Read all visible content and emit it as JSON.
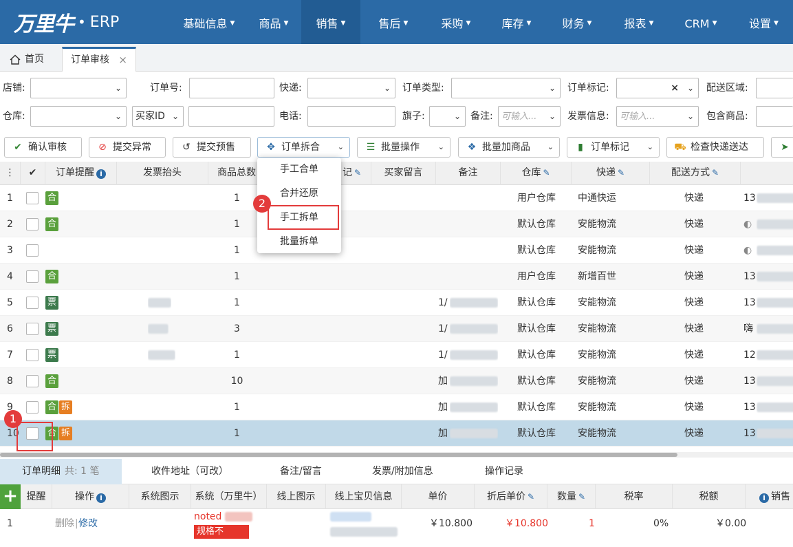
{
  "app": {
    "brand": "万里牛",
    "dot": "•",
    "product": "ERP"
  },
  "nav": [
    "基础信息",
    "商品",
    "销售",
    "售后",
    "采购",
    "库存",
    "财务",
    "报表",
    "CRM",
    "设置"
  ],
  "tabs": {
    "home": "首页",
    "current": "订单审核",
    "close": "×"
  },
  "filters": {
    "shop": "店铺:",
    "order_no": "订单号:",
    "express": "快递:",
    "order_type": "订单类型:",
    "order_mark": "订单标记:",
    "region": "配送区域:",
    "warehouse": "仓库:",
    "buyer_id": "买家ID",
    "phone": "电话:",
    "flag": "旗子:",
    "remark": "备注:",
    "remark_ph": "可输入...",
    "invoice": "发票信息:",
    "invoice_ph": "可输入...",
    "contains_goods": "包含商品:",
    "clear": "×"
  },
  "toolbar": {
    "confirm": "确认审核",
    "submit_exception": "提交异常",
    "submit_presale": "提交预售",
    "split_merge": "订单拆合",
    "batch_ops": "批量操作",
    "batch_add": "批量加商品",
    "order_mark": "订单标记",
    "check_express": "检查快递送达"
  },
  "grid": {
    "headers": [
      "订单提醒",
      "发票抬头",
      "商品总数",
      "记",
      "买家留言",
      "备注",
      "仓库",
      "快递",
      "配送方式"
    ],
    "rows": [
      {
        "n": "1",
        "badges": [
          "合"
        ],
        "qty": "1",
        "remark": "",
        "wh": "用户仓库",
        "exp": "中通快运",
        "ship": "快递",
        "extra": "13"
      },
      {
        "n": "2",
        "badges": [
          "合"
        ],
        "qty": "1",
        "remark": "",
        "wh": "默认仓库",
        "exp": "安能物流",
        "ship": "快递",
        "extra": ""
      },
      {
        "n": "3",
        "badges": [],
        "qty": "1",
        "remark": "",
        "wh": "默认仓库",
        "exp": "安能物流",
        "ship": "快递",
        "extra": ""
      },
      {
        "n": "4",
        "badges": [
          "合"
        ],
        "qty": "1",
        "remark": "",
        "wh": "用户仓库",
        "exp": "新增百世",
        "ship": "快递",
        "extra": "13"
      },
      {
        "n": "5",
        "badges": [
          "票"
        ],
        "qty": "1",
        "remark": "1/",
        "wh": "默认仓库",
        "exp": "安能物流",
        "ship": "快递",
        "extra": "13"
      },
      {
        "n": "6",
        "badges": [
          "票"
        ],
        "qty": "3",
        "remark": "1/",
        "wh": "默认仓库",
        "exp": "安能物流",
        "ship": "快递",
        "extra": "嗨"
      },
      {
        "n": "7",
        "badges": [
          "票"
        ],
        "qty": "1",
        "remark": "1/",
        "wh": "默认仓库",
        "exp": "安能物流",
        "ship": "快递",
        "extra": "12"
      },
      {
        "n": "8",
        "badges": [
          "合"
        ],
        "qty": "10",
        "remark": "加",
        "wh": "默认仓库",
        "exp": "安能物流",
        "ship": "快递",
        "extra": "13"
      },
      {
        "n": "9",
        "badges": [
          "合",
          "拆"
        ],
        "qty": "1",
        "remark": "加",
        "wh": "默认仓库",
        "exp": "安能物流",
        "ship": "快递",
        "extra": "13"
      },
      {
        "n": "10",
        "badges": [
          "合",
          "拆"
        ],
        "qty": "1",
        "remark": "加",
        "wh": "默认仓库",
        "exp": "安能物流",
        "ship": "快递",
        "extra": "13"
      }
    ]
  },
  "menu": [
    "手工合单",
    "合并还原",
    "手工拆单",
    "批量拆单"
  ],
  "annotations": {
    "one": "1",
    "two": "2"
  },
  "bottom_tabs": {
    "detail": "订单明细",
    "count": "共: 1 笔",
    "address": "收件地址（可改）",
    "notes": "备注/留言",
    "invoice": "发票/附加信息",
    "log": "操作记录"
  },
  "detail_headers": {
    "remind": "提醒",
    "ops": "操作",
    "sys_img": "系统图示",
    "sys": "系统（万里牛）",
    "online_img": "线上图示",
    "online_info": "线上宝贝信息",
    "price": "单价",
    "disc_price": "折后单价",
    "qty": "数量",
    "tax_rate": "税率",
    "tax": "税额",
    "sales": "销售"
  },
  "detail_row": {
    "n": "1",
    "delete": "删除",
    "sep": "|",
    "edit": "修改",
    "sys_name": "noted",
    "spec": "规格不",
    "price": "￥10.800",
    "disc_price": "￥10.800",
    "qty": "1",
    "tax_rate": "0%",
    "tax": "￥0.00"
  },
  "colors": {
    "nav": "#2b6aa6",
    "accent_red": "#e33b3b",
    "he_badge": "#5aa03c",
    "piao_badge": "#3c7a4c",
    "chai_badge": "#e67e22",
    "selected_row": "#c1d9e8"
  }
}
